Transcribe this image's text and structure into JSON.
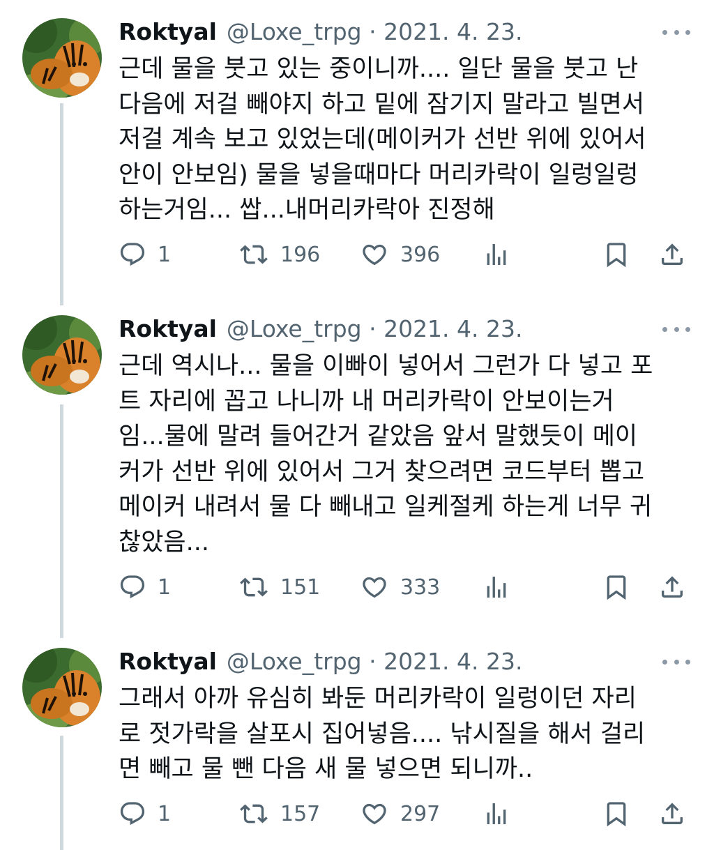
{
  "tweets": [
    {
      "name": "Roktyal",
      "meta": "@Loxe_trpg · 2021. 4. 23.",
      "lines": [
        "근데 물을 붓고 있는 중이니까.... 일단 물을 붓고 난",
        "다음에 저걸 빼야지 하고 밑에 잠기지 말라고 빌면서",
        "저걸 계속 보고 있었는데(메이커가 선반 위에 있어서",
        "안이 안보임) 물을 넣을때마다 머리카락이 일렁일렁",
        "하는거임... 쌉...내머리카락아 진정해"
      ],
      "replies": "1",
      "retweets": "196",
      "likes": "396"
    },
    {
      "name": "Roktyal",
      "meta": "@Loxe_trpg · 2021. 4. 23.",
      "lines": [
        "근데 역시나... 물을 이빠이 넣어서 그런가 다 넣고 포",
        "트 자리에 꼽고 나니까 내 머리카락이 안보이는거",
        "임...물에 말려 들어간거 같았음 앞서 말했듯이 메이",
        "커가 선반 위에 있어서 그거 찾으려면 코드부터 뽑고",
        "메이커 내려서 물 다 빼내고 일케절케 하는게 너무 귀",
        "찮았음..."
      ],
      "replies": "1",
      "retweets": "151",
      "likes": "333"
    },
    {
      "name": "Roktyal",
      "meta": "@Loxe_trpg · 2021. 4. 23.",
      "lines": [
        "그래서 아까 유심히 봐둔 머리카락이 일렁이던 자리",
        "로 젓가락을 살포시 집어넣음.... 낚시질을 해서 걸리",
        "면 빼고 물 뺀 다음 새 물 넣으면 되니까.."
      ],
      "replies": "1",
      "retweets": "157",
      "likes": "297"
    }
  ],
  "icons": {
    "reply": "reply-icon",
    "retweet": "retweet-icon",
    "like": "heart-icon",
    "views": "analytics-icon",
    "bookmark": "bookmark-icon",
    "share": "share-icon",
    "more": "more-options-icon"
  },
  "colors": {
    "text": "#0f1419",
    "secondary": "#536471",
    "thread_line": "#cfd9de"
  }
}
